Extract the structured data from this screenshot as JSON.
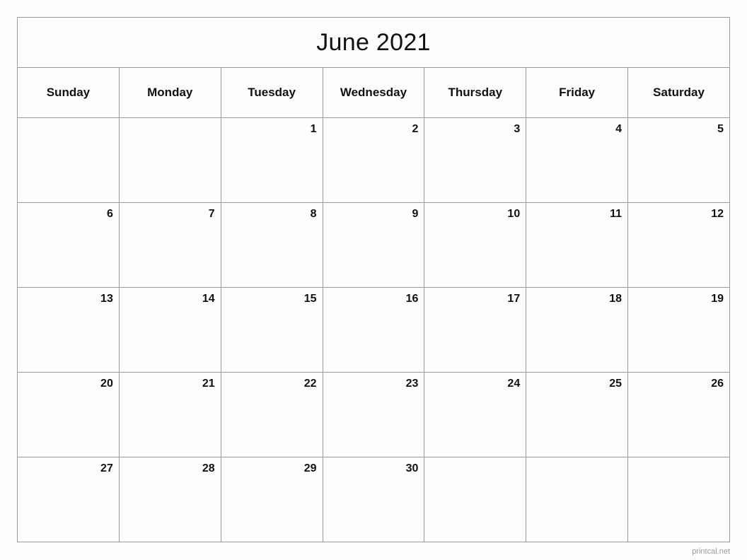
{
  "calendar": {
    "title": "June 2021",
    "month": "June",
    "year": "2021",
    "weekday_headers": [
      "Sunday",
      "Monday",
      "Tuesday",
      "Wednesday",
      "Thursday",
      "Friday",
      "Saturday"
    ],
    "weeks": [
      [
        "",
        "",
        "1",
        "2",
        "3",
        "4",
        "5"
      ],
      [
        "6",
        "7",
        "8",
        "9",
        "10",
        "11",
        "12"
      ],
      [
        "13",
        "14",
        "15",
        "16",
        "17",
        "18",
        "19"
      ],
      [
        "20",
        "21",
        "22",
        "23",
        "24",
        "25",
        "26"
      ],
      [
        "27",
        "28",
        "29",
        "30",
        "",
        "",
        ""
      ]
    ]
  },
  "footer": {
    "watermark": "printcal.net"
  },
  "colors": {
    "background": "#fcfffc",
    "border": "#9a9a9a",
    "text": "#111111",
    "watermark": "#9b9b9b"
  }
}
